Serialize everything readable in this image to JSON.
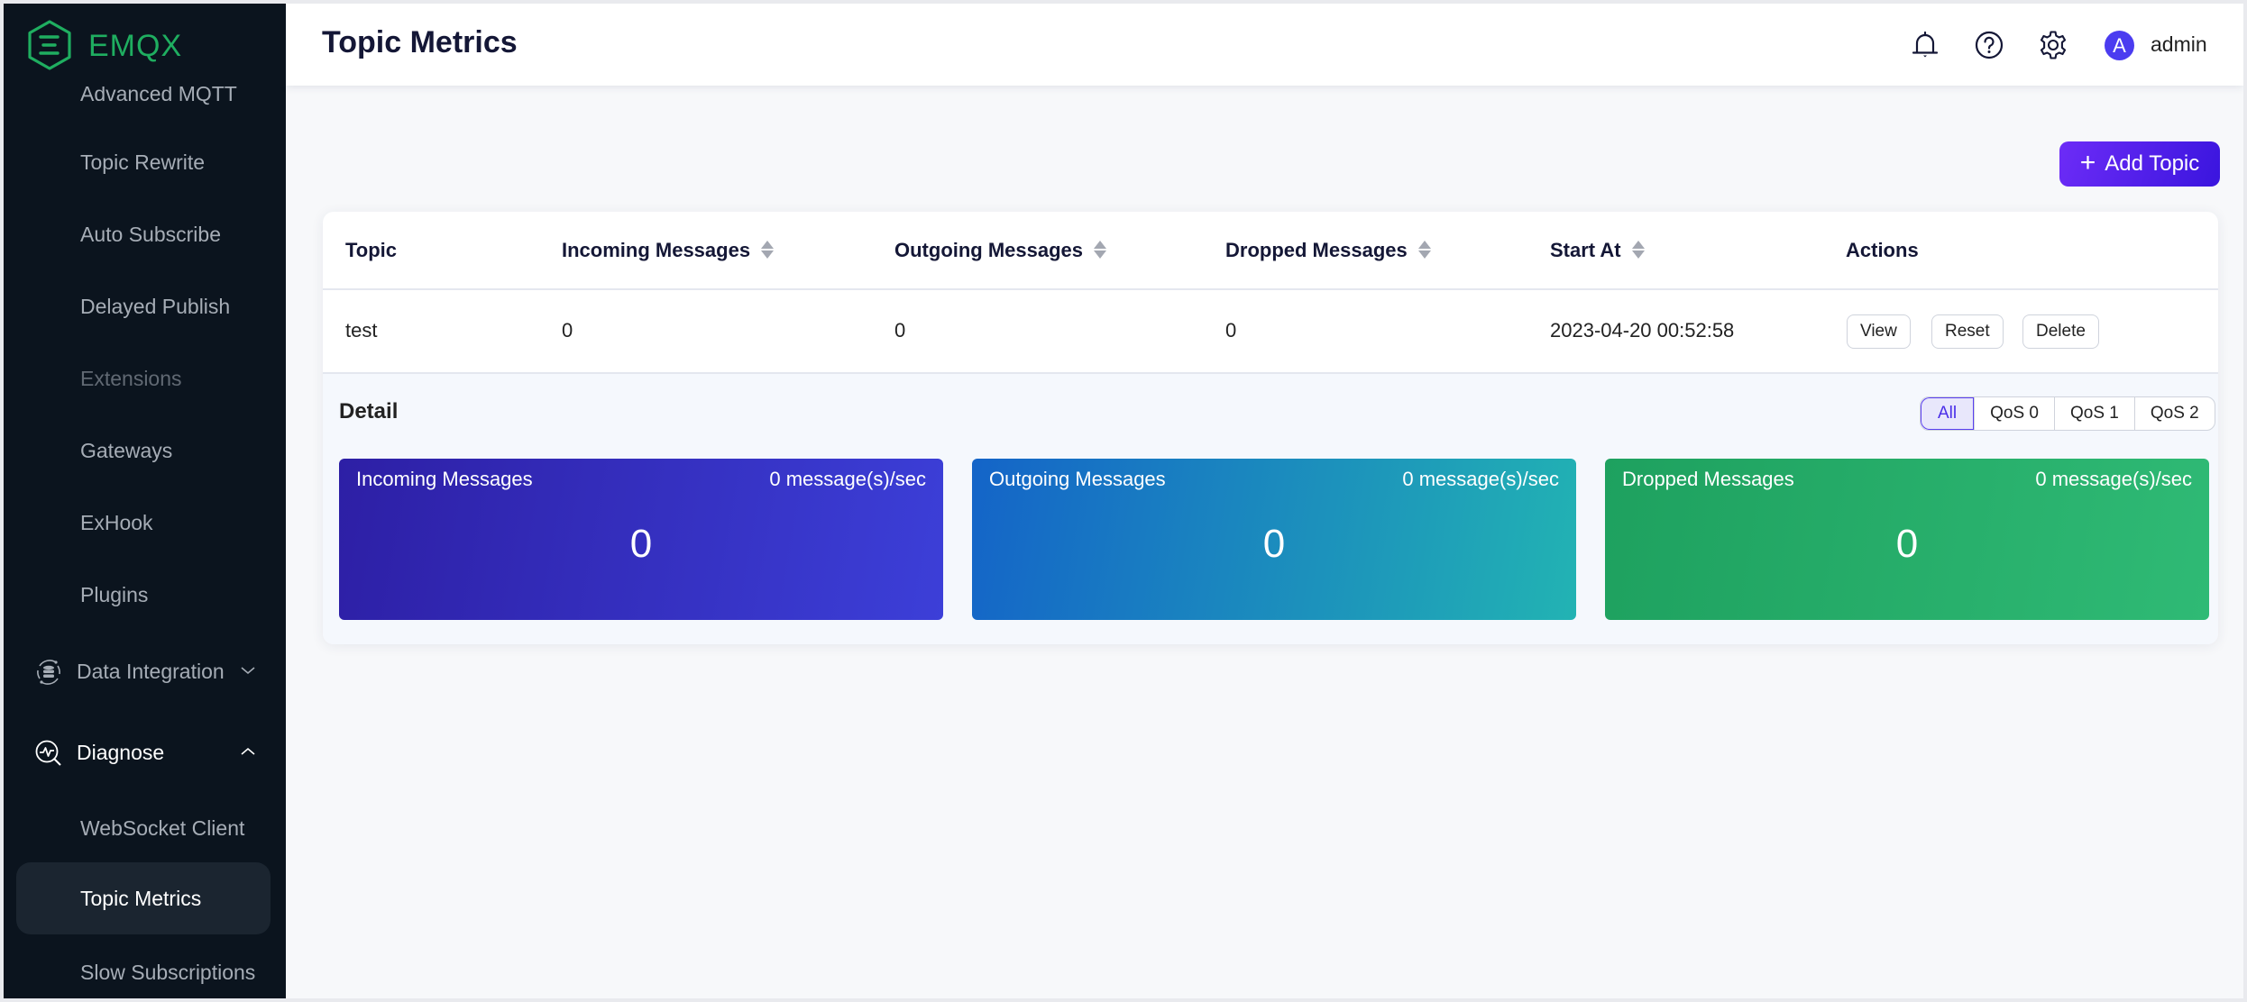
{
  "app": {
    "brand": "EMQX",
    "brand_color": "#1fae60",
    "accent_color": "#4b3cf0"
  },
  "sidebar": {
    "items": [
      {
        "label": "Advanced MQTT",
        "state": "partially-hidden"
      },
      {
        "label": "Topic Rewrite"
      },
      {
        "label": "Auto Subscribe"
      },
      {
        "label": "Delayed Publish"
      },
      {
        "label": "Extensions",
        "state": "disabled"
      },
      {
        "label": "Gateways"
      },
      {
        "label": "ExHook"
      },
      {
        "label": "Plugins"
      }
    ],
    "groups": [
      {
        "label": "Data Integration",
        "icon": "data-integration-icon",
        "expanded": false
      },
      {
        "label": "Diagnose",
        "icon": "diagnose-icon",
        "expanded": true,
        "children": [
          {
            "label": "WebSocket Client"
          },
          {
            "label": "Topic Metrics",
            "active": true
          },
          {
            "label": "Slow Subscriptions"
          }
        ]
      }
    ]
  },
  "header": {
    "title": "Topic Metrics",
    "icons": [
      "bell-icon",
      "help-icon",
      "gear-icon"
    ],
    "user": {
      "avatar_letter": "A",
      "name": "admin"
    }
  },
  "toolbar": {
    "add_topic_label": "Add Topic"
  },
  "table": {
    "columns": [
      {
        "label": "Topic",
        "sortable": false
      },
      {
        "label": "Incoming Messages",
        "sortable": true
      },
      {
        "label": "Outgoing Messages",
        "sortable": true
      },
      {
        "label": "Dropped Messages",
        "sortable": true
      },
      {
        "label": "Start At",
        "sortable": true
      },
      {
        "label": "Actions",
        "sortable": false
      }
    ],
    "rows": [
      {
        "topic": "test",
        "incoming": "0",
        "outgoing": "0",
        "dropped": "0",
        "start_at": "2023-04-20 00:52:58",
        "actions": [
          "View",
          "Reset",
          "Delete"
        ]
      }
    ]
  },
  "detail": {
    "title": "Detail",
    "qos_options": [
      "All",
      "QoS 0",
      "QoS 1",
      "QoS 2"
    ],
    "qos_selected": "All",
    "metrics": [
      {
        "title": "Incoming Messages",
        "rate": "0 message(s)/sec",
        "value": "0",
        "color_from": "#2d1fa5",
        "color_to": "#3c3fd8"
      },
      {
        "title": "Outgoing Messages",
        "rate": "0 message(s)/sec",
        "value": "0",
        "color_from": "#1464c8",
        "color_to": "#22b3b3"
      },
      {
        "title": "Dropped Messages",
        "rate": "0 message(s)/sec",
        "value": "0",
        "color_from": "#1ea15f",
        "color_to": "#2fba75"
      }
    ]
  }
}
